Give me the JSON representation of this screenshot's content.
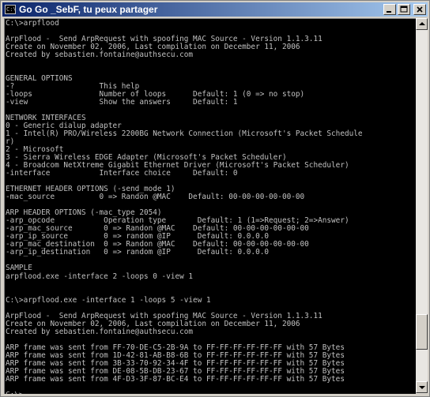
{
  "window": {
    "title": "Go Go _SebF, tu peux partager",
    "app_icon": "command-prompt-icon",
    "buttons": {
      "minimize": "minimize-icon",
      "maximize": "maximize-icon",
      "close": "close-icon"
    }
  },
  "console": {
    "lines": [
      "C:\\>arpflood",
      "",
      "ArpFlood -  Send ArpRequest with spoofing MAC Source - Version 1.1.3.11",
      "Create on November 02, 2006, Last compilation on December 11, 2006",
      "Created by sebastien.fontaine@authsecu.com",
      "",
      "",
      "GENERAL OPTIONS",
      "-?                   This help",
      "-loops               Number of loops      Default: 1 (0 => no stop)",
      "-view                Show the answers     Default: 1",
      "",
      "NETWORK INTERFACES",
      "0 - Generic dialup adapter",
      "1 - Intel(R) PRO/Wireless 2200BG Network Connection (Microsoft's Packet Schedule",
      "r)",
      "2 - Microsoft",
      "3 - Sierra Wireless EDGE Adapter (Microsoft's Packet Scheduler)",
      "4 - Broadcom NetXtreme Gigabit Ethernet Driver (Microsoft's Packet Scheduler)",
      "-interface           Interface choice     Default: 0",
      "",
      "ETHERNET HEADER OPTIONS (-send_mode 1)",
      "-mac_source          0 => Randon @MAC    Default: 00-00-00-00-00-00",
      "",
      "ARP HEADER OPTIONS (-mac_type 2054)",
      "-arp_opcode           Operation type       Default: 1 (1=>Request; 2=>Answer)",
      "-arp_mac_source       0 => Randon @MAC    Default: 00-00-00-00-00-00",
      "-arp_ip_source        0 => random @IP      Default: 0.0.0.0",
      "-arp_mac_destination  0 => Randon @MAC    Default: 00-00-00-00-00-00",
      "-arp_ip_destination   0 => random @IP      Default: 0.0.0.0",
      "",
      "SAMPLE",
      "arpflood.exe -interface 2 -loops 0 -view 1",
      "",
      "",
      "C:\\>arpflood.exe -interface 1 -loops 5 -view 1",
      "",
      "ArpFlood -  Send ArpRequest with spoofing MAC Source - Version 1.1.3.11",
      "Create on November 02, 2006, Last compilation on December 11, 2006",
      "Created by sebastien.fontaine@authsecu.com",
      "",
      "ARP frame was sent from FF-70-DE-C5-2B-9A to FF-FF-FF-FF-FF-FF with 57 Bytes",
      "ARP frame was sent from 1D-42-81-AB-B8-6B to FF-FF-FF-FF-FF-FF with 57 Bytes",
      "ARP frame was sent from 3B-33-70-92-34-4F to FF-FF-FF-FF-FF-FF with 57 Bytes",
      "ARP frame was sent from DE-08-5B-DB-23-67 to FF-FF-FF-FF-FF-FF with 57 Bytes",
      "ARP frame was sent from 4F-D3-3F-87-BC-E4 to FF-FF-FF-FF-FF-FF with 57 Bytes",
      "",
      "C:\\>_"
    ]
  },
  "scrollbar": {
    "position_fraction": 0.9,
    "visible_fraction": 0.1
  }
}
